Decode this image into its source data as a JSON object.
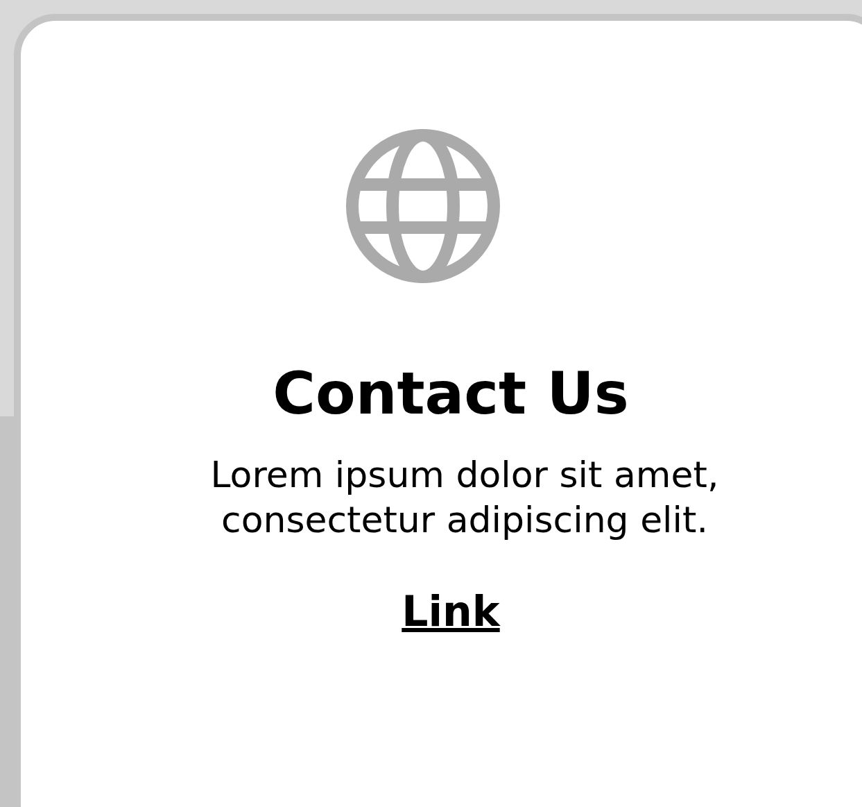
{
  "card": {
    "title": "Contact Us",
    "text": "Lorem ipsum dolor sit amet, consectetur adipiscing elit.",
    "link": "Link"
  }
}
